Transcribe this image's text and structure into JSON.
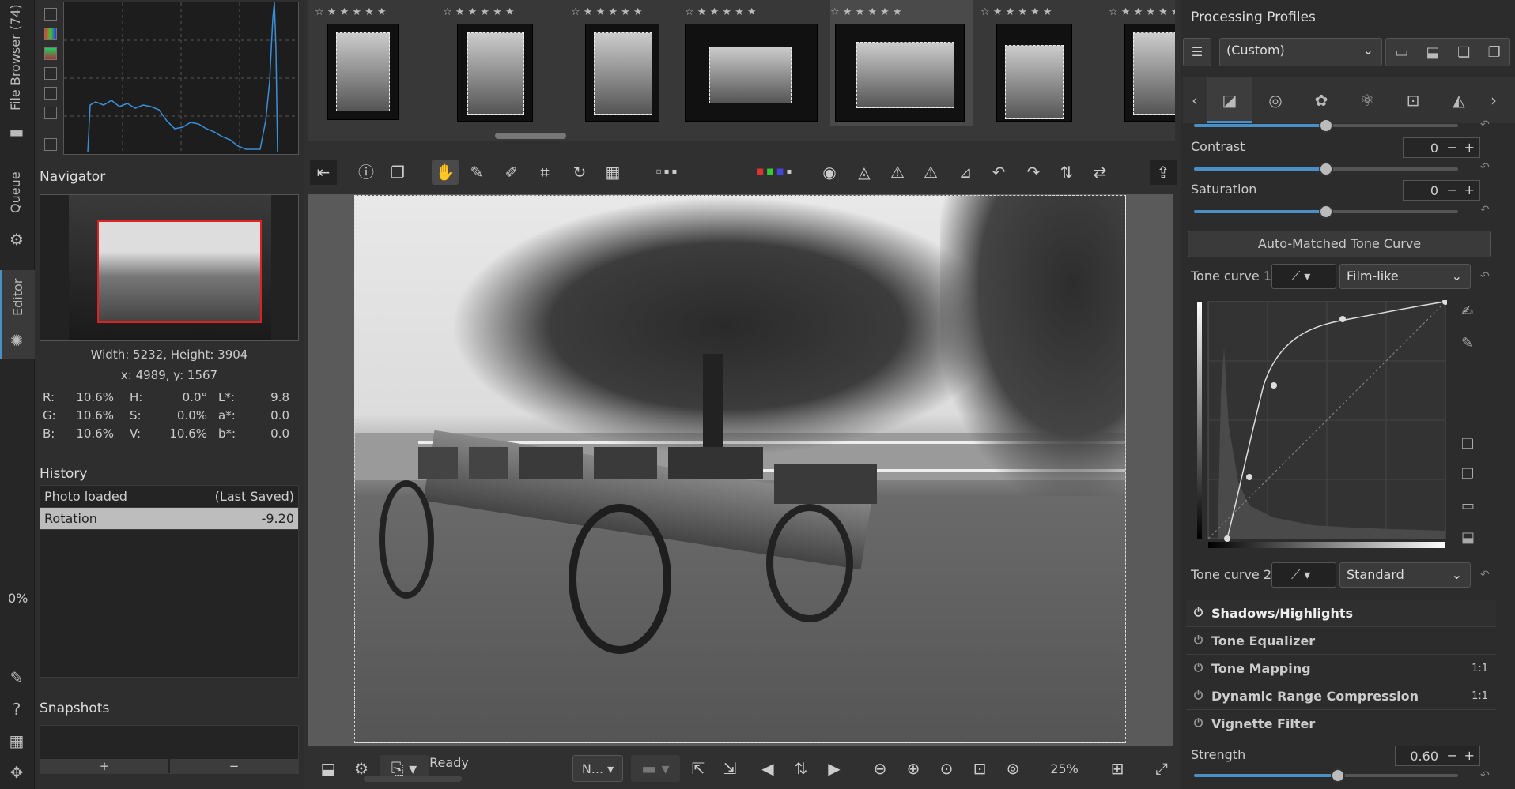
{
  "vtabs": {
    "file_browser": "File Browser (74)",
    "queue": "Queue",
    "editor": "Editor",
    "progress": "0%"
  },
  "histogram": {
    "buttons": [
      "black-square-icon",
      "rgb-icon",
      "color-icon",
      "chroma-icon",
      "raw-icon",
      "grid-icon",
      "bar-icon"
    ]
  },
  "navigator": {
    "title": "Navigator",
    "size": "Width: 5232, Height: 3904",
    "coords": "x: 4989, y: 1567",
    "values": [
      {
        "k": "R:",
        "v": "10.6%",
        "k2": "H:",
        "v2": "0.0°",
        "k3": "L*:",
        "v3": "9.8"
      },
      {
        "k": "G:",
        "v": "10.6%",
        "k2": "S:",
        "v2": "0.0%",
        "k3": "a*:",
        "v3": "0.0"
      },
      {
        "k": "B:",
        "v": "10.6%",
        "k2": "V:",
        "v2": "10.6%",
        "k3": "b*:",
        "v3": "0.0"
      }
    ]
  },
  "history": {
    "title": "History",
    "rows": [
      {
        "name": "Photo loaded",
        "value": "(Last Saved)"
      },
      {
        "name": "Rotation",
        "value": "-9.20"
      }
    ]
  },
  "snapshots": {
    "title": "Snapshots",
    "add": "+",
    "remove": "−"
  },
  "filmstrip": {
    "stars": "☆ ★ ★ ★ ★ ★"
  },
  "status": {
    "ready": "Ready",
    "zoom": "25%",
    "combo": "N..."
  },
  "right": {
    "title": "Processing Profiles",
    "profile": "(Custom)",
    "contrast_label": "Contrast",
    "contrast_value": "0",
    "saturation_label": "Saturation",
    "saturation_value": "0",
    "auto_curve": "Auto-Matched Tone Curve",
    "tc1_label": "Tone curve 1:",
    "tc1_mode": "Film-like",
    "tc2_label": "Tone curve 2:",
    "tc2_mode": "Standard",
    "sections": [
      {
        "label": "Shadows/Highlights",
        "extra": ""
      },
      {
        "label": "Tone Equalizer",
        "extra": ""
      },
      {
        "label": "Tone Mapping",
        "extra": "1:1"
      },
      {
        "label": "Dynamic Range Compression",
        "extra": "1:1"
      },
      {
        "label": "Vignette Filter",
        "extra": ""
      }
    ],
    "strength_label": "Strength",
    "strength_value": "0.60"
  },
  "colors": {
    "accent": "#4a90c8",
    "bg": "#303030"
  }
}
